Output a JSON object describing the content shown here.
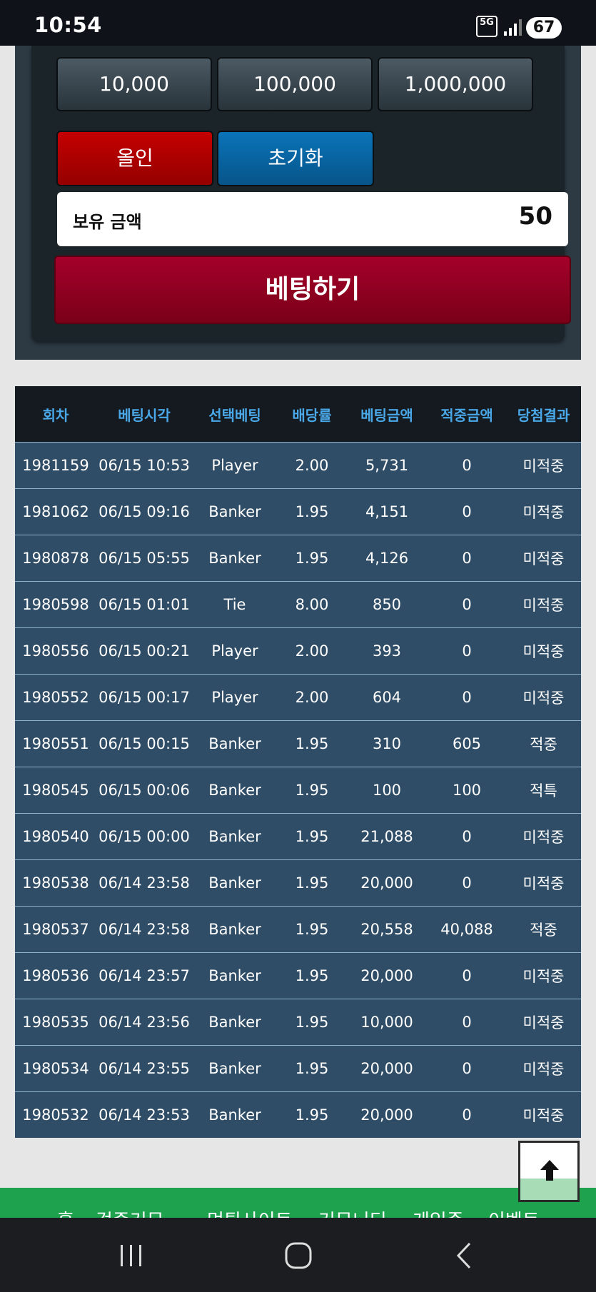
{
  "status_bar": {
    "time": "10:54",
    "network": "5G",
    "battery": "67"
  },
  "bet_panel": {
    "chips": [
      "10,000",
      "100,000",
      "1,000,000"
    ],
    "allin_label": "올인",
    "reset_label": "초기화",
    "balance_label": "보유 금액",
    "balance_value": "50",
    "bet_button_label": "베팅하기"
  },
  "history": {
    "columns": [
      "회차",
      "베팅시각",
      "선택베팅",
      "배당률",
      "베팅금액",
      "적중금액",
      "당첨결과"
    ],
    "rows": [
      [
        "1981159",
        "06/15 10:53",
        "Player",
        "2.00",
        "5,731",
        "0",
        "미적중"
      ],
      [
        "1981062",
        "06/15 09:16",
        "Banker",
        "1.95",
        "4,151",
        "0",
        "미적중"
      ],
      [
        "1980878",
        "06/15 05:55",
        "Banker",
        "1.95",
        "4,126",
        "0",
        "미적중"
      ],
      [
        "1980598",
        "06/15 01:01",
        "Tie",
        "8.00",
        "850",
        "0",
        "미적중"
      ],
      [
        "1980556",
        "06/15 00:21",
        "Player",
        "2.00",
        "393",
        "0",
        "미적중"
      ],
      [
        "1980552",
        "06/15 00:17",
        "Player",
        "2.00",
        "604",
        "0",
        "미적중"
      ],
      [
        "1980551",
        "06/15 00:15",
        "Banker",
        "1.95",
        "310",
        "605",
        "적중"
      ],
      [
        "1980545",
        "06/15 00:06",
        "Banker",
        "1.95",
        "100",
        "100",
        "적특"
      ],
      [
        "1980540",
        "06/15 00:00",
        "Banker",
        "1.95",
        "21,088",
        "0",
        "미적중"
      ],
      [
        "1980538",
        "06/14 23:58",
        "Banker",
        "1.95",
        "20,000",
        "0",
        "미적중"
      ],
      [
        "1980537",
        "06/14 23:58",
        "Banker",
        "1.95",
        "20,558",
        "40,088",
        "적중"
      ],
      [
        "1980536",
        "06/14 23:57",
        "Banker",
        "1.95",
        "20,000",
        "0",
        "미적중"
      ],
      [
        "1980535",
        "06/14 23:56",
        "Banker",
        "1.95",
        "10,000",
        "0",
        "미적중"
      ],
      [
        "1980534",
        "06/14 23:55",
        "Banker",
        "1.95",
        "20,000",
        "0",
        "미적중"
      ],
      [
        "1980532",
        "06/14 23:53",
        "Banker",
        "1.95",
        "20,000",
        "0",
        "미적중"
      ]
    ],
    "result_colors": {
      "lose": "#d22a2a",
      "win": "#f0a820"
    }
  },
  "scroll_top": {
    "icon": "arrow-up-icon"
  },
  "footer_nav": {
    "items": [
      "홈",
      "검증커뮤",
      "먹튀사이트",
      "커뮤니티",
      "게임존",
      "이벤트"
    ]
  },
  "android_nav": {
    "icons": [
      "recent-apps-icon",
      "home-icon",
      "back-icon"
    ]
  }
}
